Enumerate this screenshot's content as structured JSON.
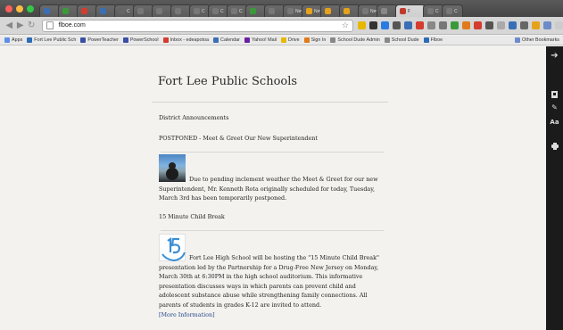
{
  "browser": {
    "traffic_colors": [
      "#fc605c",
      "#fdbc40",
      "#34c84a"
    ],
    "tabs": [
      {
        "label": "",
        "fav_color": "#3b6fb5"
      },
      {
        "label": "",
        "fav_color": "#3a9a3a"
      },
      {
        "label": "",
        "fav_color": "#d33c2f"
      },
      {
        "label": "",
        "fav_color": "#3b6fb5"
      },
      {
        "label": "C",
        "fav_color": "#666"
      },
      {
        "label": "",
        "fav_color": "#777"
      },
      {
        "label": "",
        "fav_color": "#777"
      },
      {
        "label": "",
        "fav_color": "#777"
      },
      {
        "label": "C",
        "fav_color": "#777"
      },
      {
        "label": "C",
        "fav_color": "#777"
      },
      {
        "label": "C",
        "fav_color": "#777"
      },
      {
        "label": "",
        "fav_color": "#3a9a3a"
      },
      {
        "label": "",
        "fav_color": "#777"
      },
      {
        "label": "New",
        "fav_color": "#777"
      },
      {
        "label": "Nev",
        "fav_color": "#e6a21a"
      },
      {
        "label": "",
        "fav_color": "#e6a21a"
      },
      {
        "label": "",
        "fav_color": "#e6a21a"
      },
      {
        "label": "New",
        "fav_color": "#777"
      },
      {
        "label": "",
        "fav_color": "#888"
      },
      {
        "label": "F",
        "fav_color": "#c0392b",
        "active": true
      },
      {
        "label": "C",
        "fav_color": "#777"
      },
      {
        "label": "C",
        "fav_color": "#777"
      }
    ],
    "url": "flboe.com",
    "ext_colors": [
      "#e6b800",
      "#333",
      "#2a7ae2",
      "#555",
      "#3b6fb5",
      "#d33c2f",
      "#888",
      "#777",
      "#3a9a3a",
      "#e07a1a",
      "#d33c2f",
      "#555",
      "#aaa",
      "#3b6fb5",
      "#666",
      "#e6a21a",
      "#6d8bc9",
      "#ccc"
    ],
    "bookmarks": [
      {
        "label": "Apps",
        "color": "#5c8ee6"
      },
      {
        "label": "Fort Lee Public Sch",
        "color": "#2d6cb5"
      },
      {
        "label": "PowerTeacher",
        "color": "#3a4fa3"
      },
      {
        "label": "PowerSchool",
        "color": "#3a4fa3"
      },
      {
        "label": "Inbox - edeapotoa",
        "color": "#d33c2f"
      },
      {
        "label": "Calendar",
        "color": "#3b6fb5"
      },
      {
        "label": "Yahoo! Mail",
        "color": "#6a1fa3"
      },
      {
        "label": "Drive",
        "color": "#e6b800"
      },
      {
        "label": "Sign In",
        "color": "#e07a1a"
      },
      {
        "label": "School Dude Admin",
        "color": "#888"
      },
      {
        "label": "School Dude",
        "color": "#888"
      },
      {
        "label": "Flboe",
        "color": "#2d6cb5"
      }
    ],
    "other_bookmarks": "Other Bookmarks"
  },
  "page": {
    "site_title": "Fort Lee Public Schools",
    "section_title": "District Announcements",
    "articles": [
      {
        "title": "POSTPONED - Meet & Greet Our New Superintendent",
        "body": "Due to pending inclement weather the Meet & Greet for our new Superintendent, Mr. Kenneth Rota originally scheduled for today, Tuesday, March 3rd has been temporarily postponed."
      },
      {
        "title": "15 Minute Child Break",
        "body": "Fort Lee High School will be hosting the \"15 Minute Child Break\" presentation led by the Partnership for a Drug-Free New Jersey on Monday, March 30th at 6:30PM in the high school auditorium. This informative presentation discusses ways in which parents can prevent child and adolescent substance abuse while strengthening family connections. All parents of students in grades K-12 are invited to attend.",
        "more_link": "[More Information]"
      }
    ]
  },
  "rightbar": {
    "icons": [
      "back-arrow-icon",
      "bookmark-page-icon",
      "highlighter-icon",
      "font-size-icon",
      "print-icon"
    ],
    "font_label": "Aa"
  }
}
